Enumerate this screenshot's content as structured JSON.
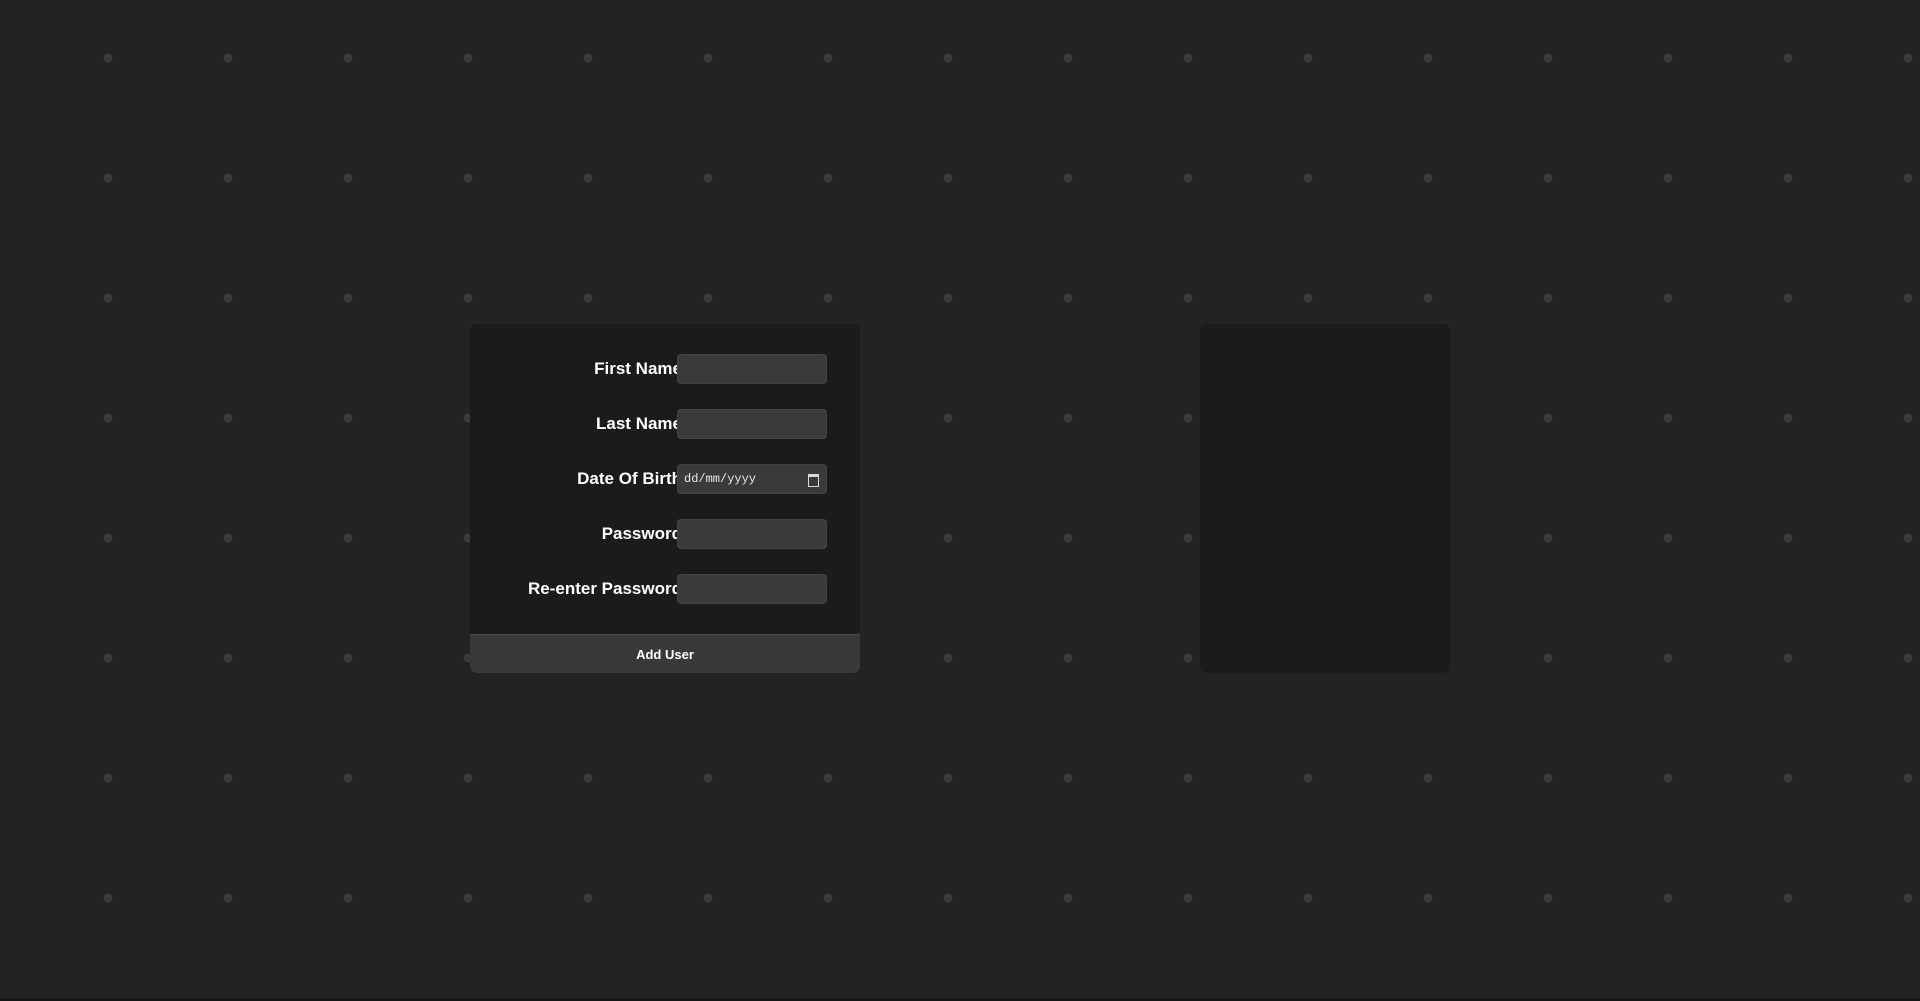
{
  "form": {
    "first_name": {
      "label": "First Name",
      "value": "",
      "placeholder": ""
    },
    "last_name": {
      "label": "Last Name",
      "value": "",
      "placeholder": ""
    },
    "date_of_birth": {
      "label": "Date Of Birth",
      "placeholder": "dd/mm/yyyy"
    },
    "password": {
      "label": "Password",
      "value": "",
      "placeholder": ""
    },
    "reenter_password": {
      "label": "Re-enter Password",
      "value": "",
      "placeholder": ""
    },
    "submit_label": "Add User"
  },
  "icons": {
    "date_picker": "calendar-icon"
  },
  "colors": {
    "background": "#232323",
    "panel": "#1b1b1b",
    "input": "#3a3a3a",
    "button": "#393939",
    "text": "#ffffff",
    "grid_dot": "#3a3a3a"
  }
}
